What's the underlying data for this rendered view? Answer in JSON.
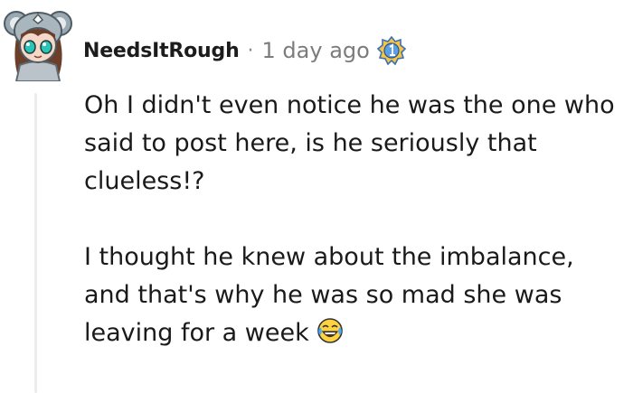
{
  "comment": {
    "username": "NeedsItRough",
    "separator": "·",
    "timestamp": "1 day ago",
    "award_icon": "award-badge-icon",
    "paragraphs": [
      "Oh I didn't even notice he was the one who said to post here, is he seriously that clueless!?",
      "I thought he knew about the imbalance, and that's why he was so mad she was leaving for a week"
    ],
    "emoji": "tears-of-joy-emoji-icon"
  },
  "colors": {
    "username": "#1c1c1c",
    "meta": "#7c7c7c",
    "body_text": "#1a1a1b",
    "thread_line": "#ececec"
  }
}
